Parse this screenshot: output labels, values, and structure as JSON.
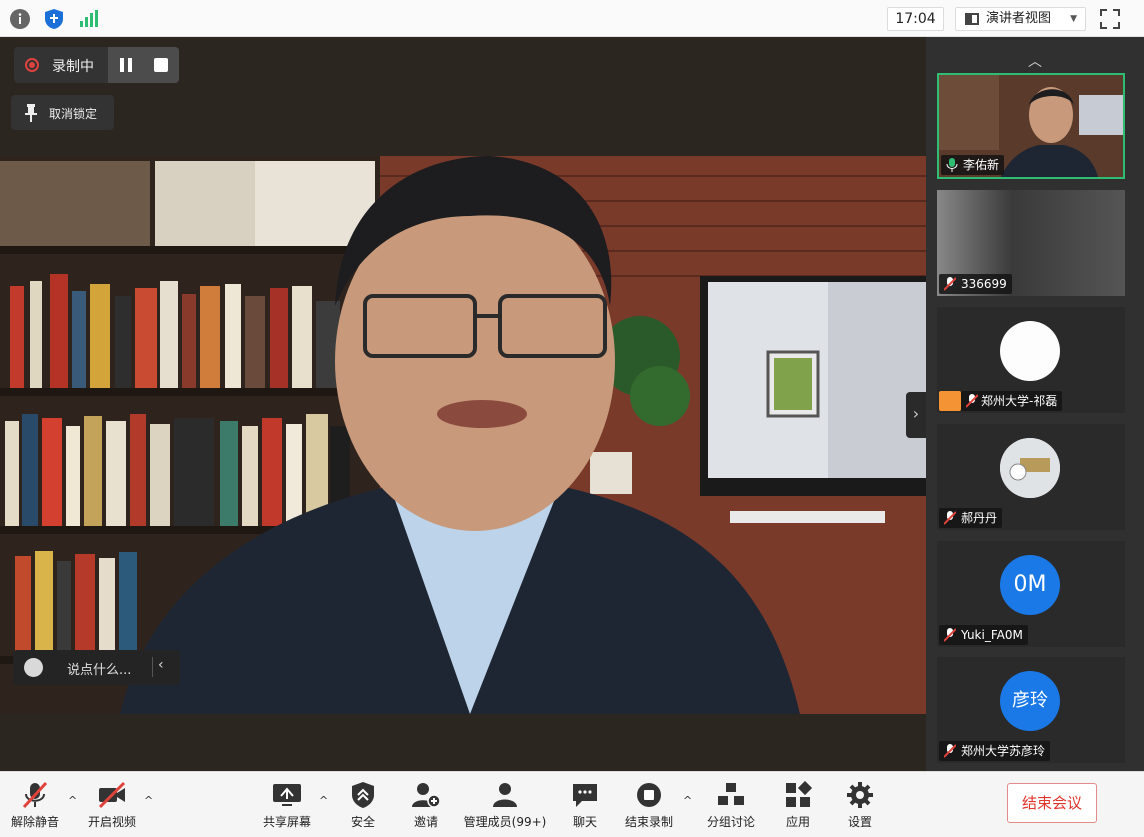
{
  "topbar": {
    "time": "17:04",
    "view_label": "演讲者视图",
    "icons": [
      "info-icon",
      "shield-icon",
      "signal-icon",
      "fullscreen-icon"
    ]
  },
  "recording": {
    "label": "录制中"
  },
  "unpin": {
    "label": "取消锁定"
  },
  "chat": {
    "placeholder": "说点什么..."
  },
  "participants": [
    {
      "name": "李佑新",
      "audio": "on",
      "active": true
    },
    {
      "name": "336699",
      "audio": "muted"
    },
    {
      "name": "郑州大学-祁磊",
      "audio": "muted"
    },
    {
      "name": "郝丹丹",
      "audio": "muted"
    },
    {
      "name": "Yuki_FA0M",
      "audio": "muted",
      "avatar_text": "0M"
    },
    {
      "name": "郑州大学苏彦玲",
      "audio": "muted",
      "avatar_text": "彦玲"
    }
  ],
  "toolbar": {
    "unmute": "解除静音",
    "start_video": "开启视频",
    "share_screen": "共享屏幕",
    "security": "安全",
    "invite": "邀请",
    "manage": "管理成员(99+)",
    "chat": "聊天",
    "stop_recording": "结束录制",
    "breakout": "分组讨论",
    "apps": "应用",
    "settings": "设置",
    "end_meeting": "结束会议"
  },
  "colors": {
    "accent_green": "#2fbc73",
    "record_red": "#e0423c",
    "end_red": "#e0352b",
    "avatar_blue": "#1a79e6"
  }
}
